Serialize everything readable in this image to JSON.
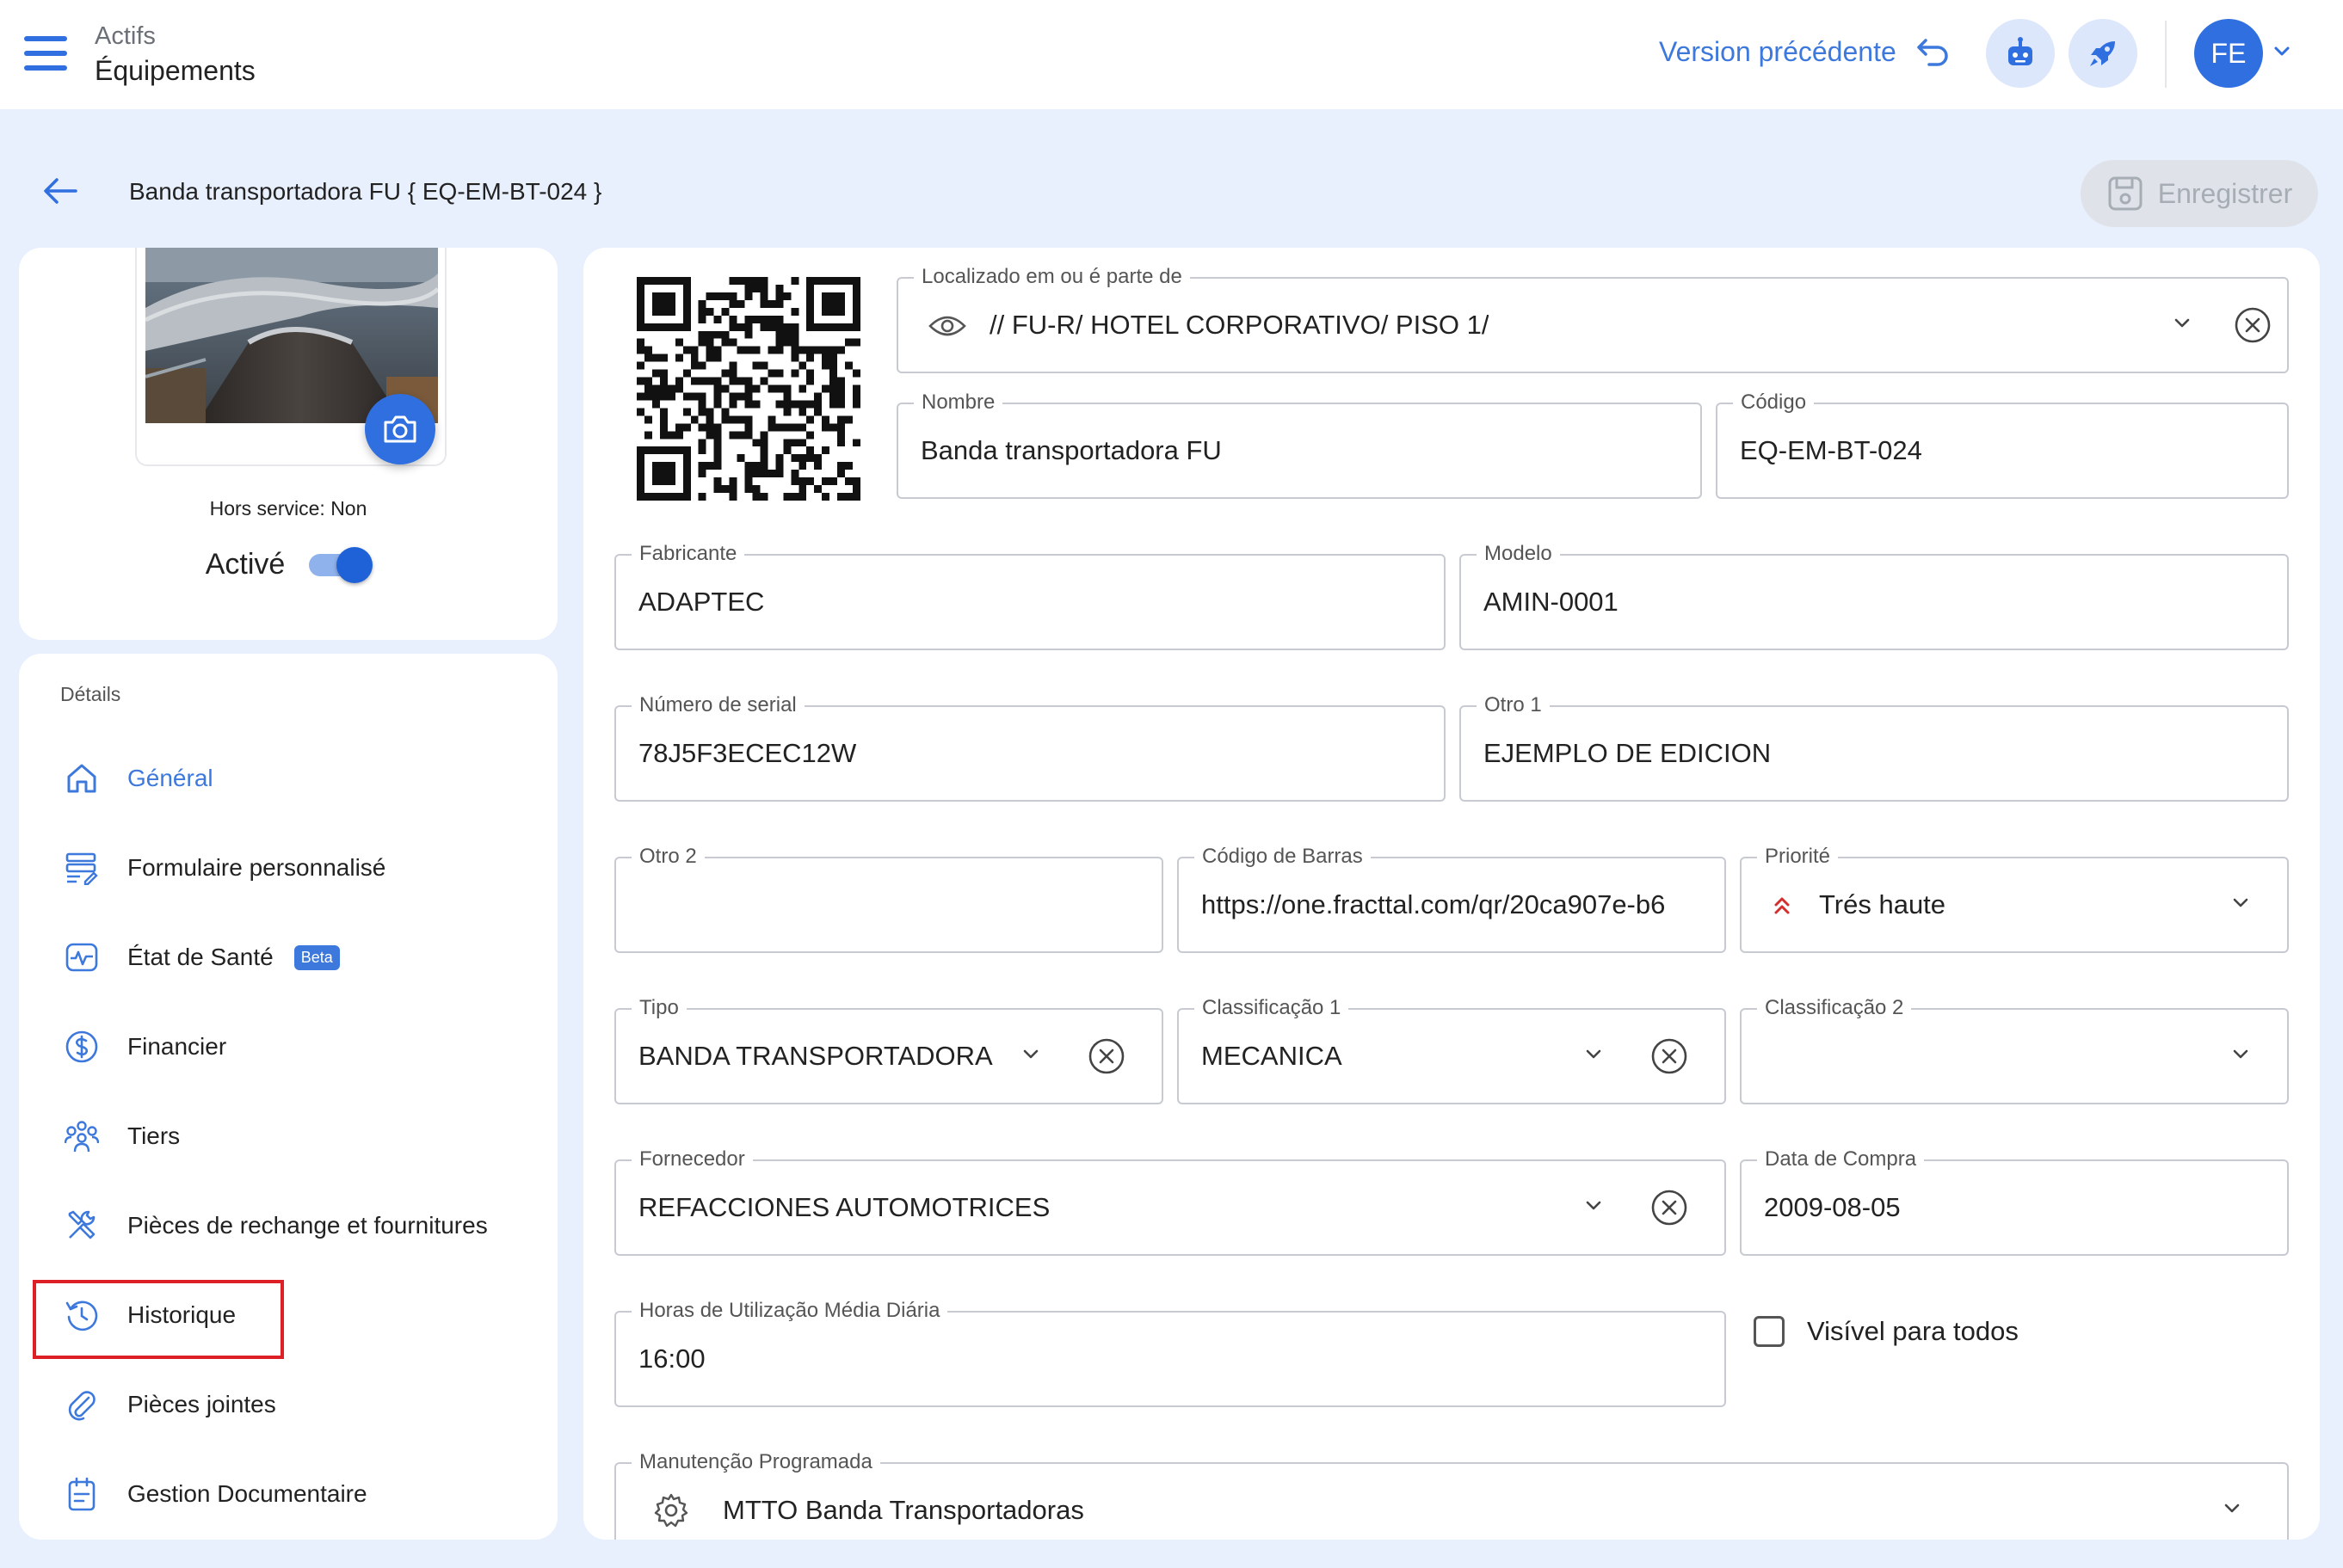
{
  "header": {
    "breadcrumb_parent": "Actifs",
    "breadcrumb_current": "Équipements",
    "previous_version": "Version précédente",
    "avatar_initials": "FE"
  },
  "page": {
    "title": "Banda transportadora FU { EQ-EM-BT-024 }",
    "save_label": "Enregistrer"
  },
  "status": {
    "out_of_service": "Hors service: Non",
    "active_label": "Activé",
    "active": true
  },
  "sidebar": {
    "section_label": "Détails",
    "items": [
      {
        "label": "Général",
        "icon": "home-icon",
        "active": true
      },
      {
        "label": "Formulaire personnalisé",
        "icon": "form-icon"
      },
      {
        "label": "État de Santé",
        "icon": "health-icon",
        "badge": "Beta"
      },
      {
        "label": "Financier",
        "icon": "dollar-icon"
      },
      {
        "label": "Tiers",
        "icon": "people-icon"
      },
      {
        "label": "Pièces de rechange et fournitures",
        "icon": "tools-icon"
      },
      {
        "label": "Historique",
        "icon": "history-icon"
      },
      {
        "label": "Pièces jointes",
        "icon": "paperclip-icon"
      },
      {
        "label": "Gestion Documentaire",
        "icon": "document-icon"
      }
    ]
  },
  "form": {
    "location": {
      "label": "Localizado em ou é parte de",
      "value": "// FU-R/ HOTEL CORPORATIVO/ PISO 1/"
    },
    "name": {
      "label": "Nombre",
      "value": "Banda transportadora FU"
    },
    "code": {
      "label": "Código",
      "value": "EQ-EM-BT-024"
    },
    "manufacturer": {
      "label": "Fabricante",
      "value": "ADAPTEC"
    },
    "model": {
      "label": "Modelo",
      "value": "AMIN-0001"
    },
    "serial": {
      "label": "Número de serial",
      "value": "78J5F3ECEC12W"
    },
    "other1": {
      "label": "Otro 1",
      "value": "EJEMPLO DE EDICION"
    },
    "other2": {
      "label": "Otro 2",
      "value": ""
    },
    "barcode": {
      "label": "Código de Barras",
      "value": "https://one.fracttal.com/qr/20ca907e-b6"
    },
    "priority": {
      "label": "Priorité",
      "value": "Trés haute",
      "color": "#d32f2f"
    },
    "type": {
      "label": "Tipo",
      "value": "BANDA TRANSPORTADORA"
    },
    "class1": {
      "label": "Classificação 1",
      "value": "MECANICA"
    },
    "class2": {
      "label": "Classificação 2",
      "value": ""
    },
    "supplier": {
      "label": "Fornecedor",
      "value": "REFACCIONES AUTOMOTRICES"
    },
    "purchase_date": {
      "label": "Data de Compra",
      "value": "2009-08-05"
    },
    "daily_hours": {
      "label": "Horas de Utilização Média Diária",
      "value": "16:00"
    },
    "visible_all": {
      "label": "Visível para todos",
      "checked": false
    },
    "maintenance": {
      "label": "Manutenção Programada",
      "value": "MTTO Banda Transportadoras"
    }
  },
  "colors": {
    "accent": "#2f6fe0",
    "link": "#3d78dc",
    "highlight": "#dd1f26",
    "background": "#e8effd"
  }
}
